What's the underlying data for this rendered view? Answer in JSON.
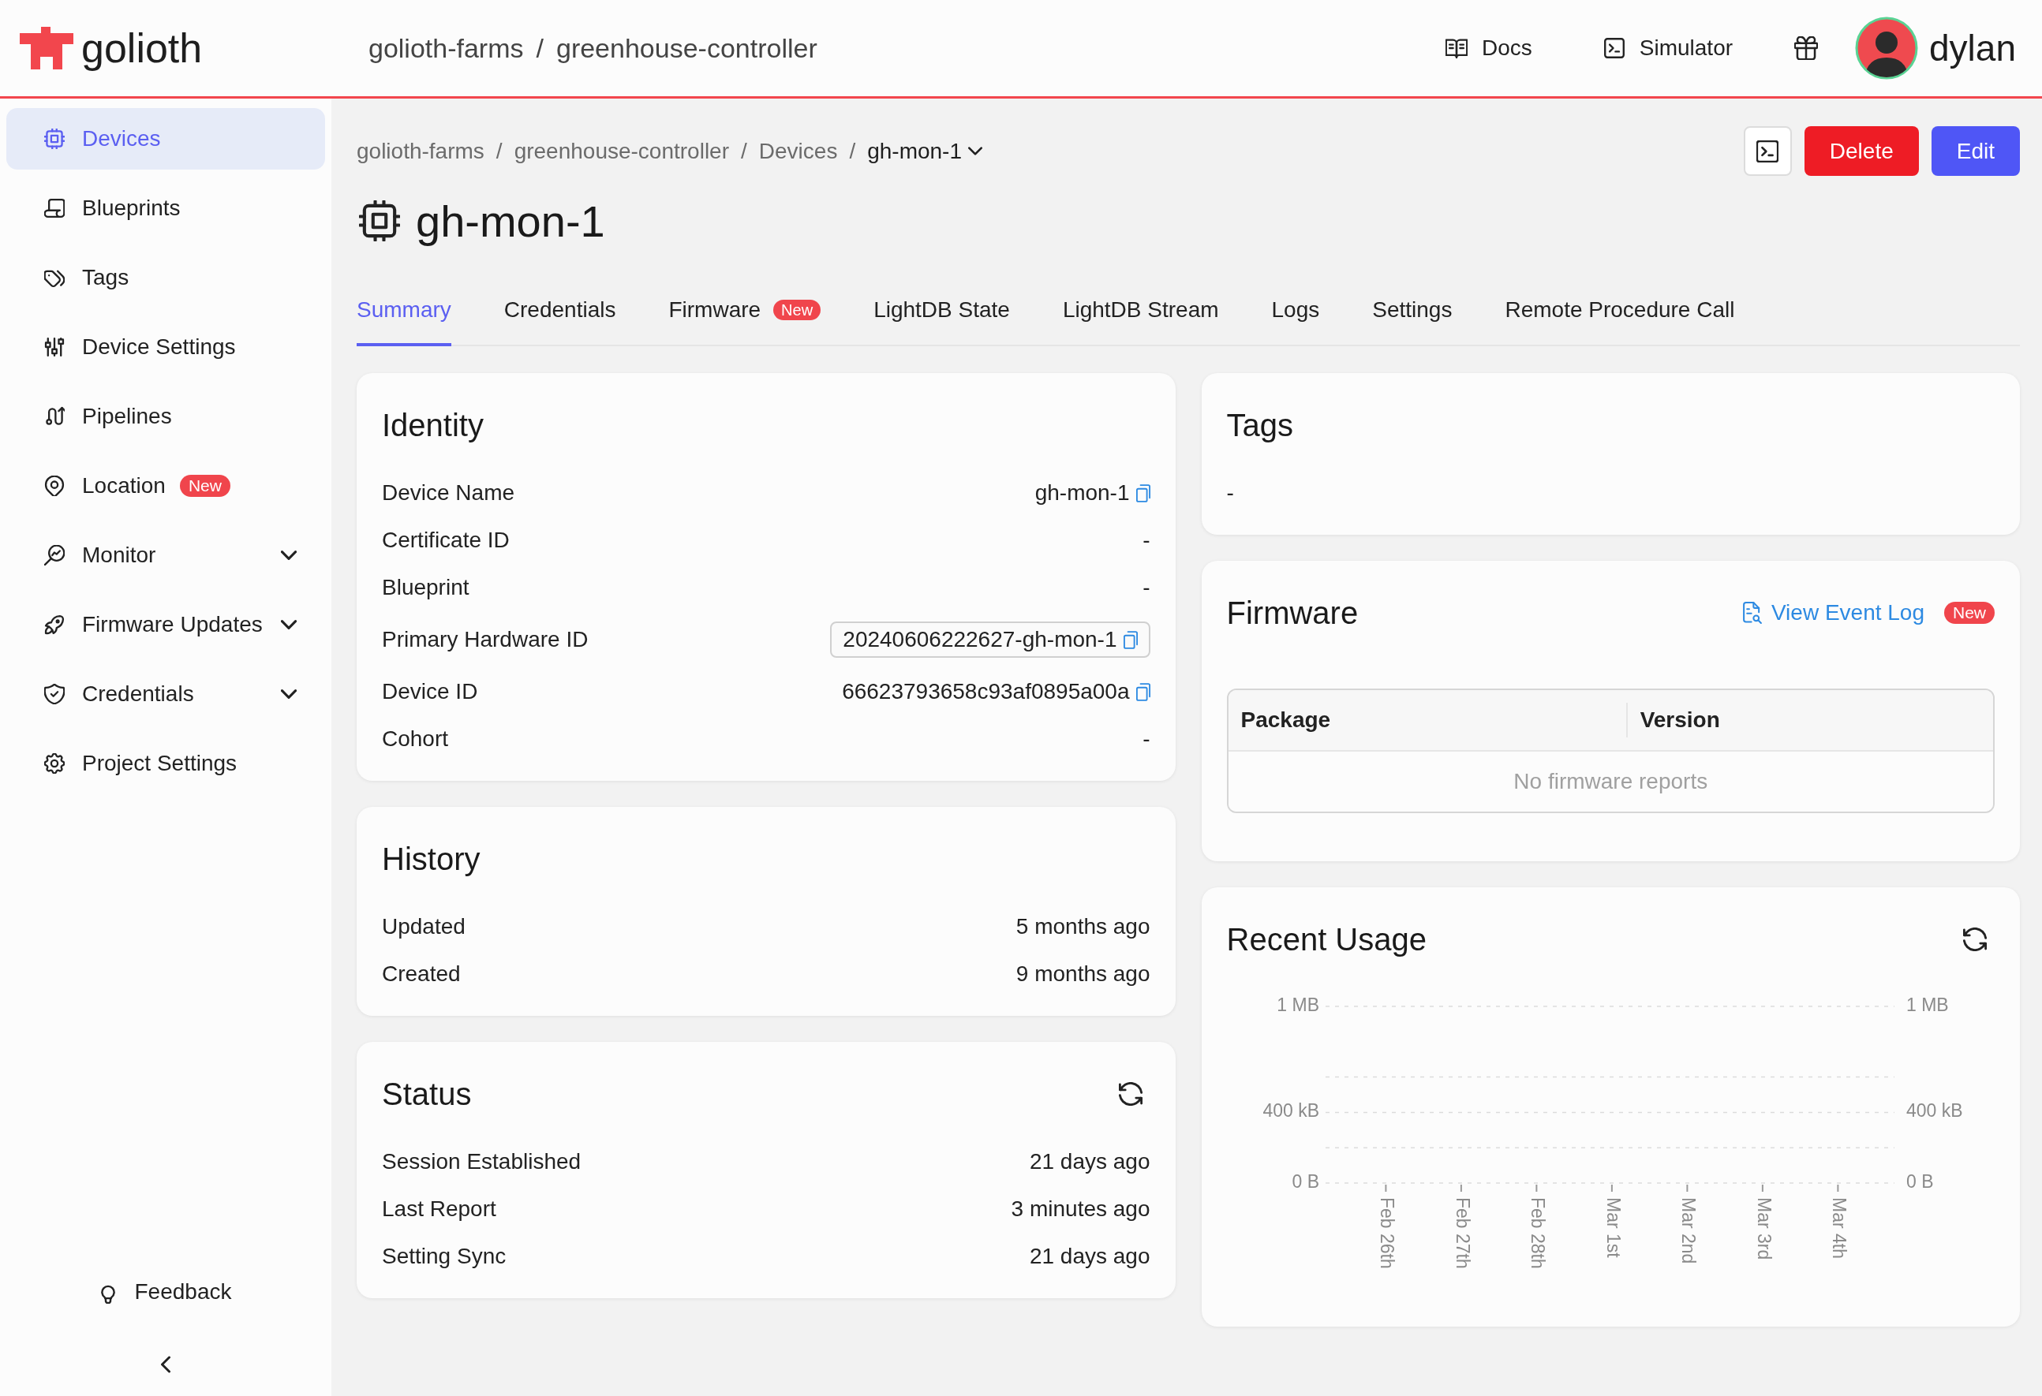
{
  "header": {
    "logo": "golioth",
    "breadcrumb": [
      {
        "kind": "link",
        "text": "golioth-farms"
      },
      {
        "kind": "separator",
        "text": "/"
      },
      {
        "kind": "link",
        "text": "greenhouse-controller"
      }
    ],
    "nav": [
      {
        "label": "Docs"
      },
      {
        "label": "Simulator"
      }
    ],
    "user": {
      "name": "dylan"
    }
  },
  "sidebar": {
    "items": [
      {
        "label": "Devices",
        "selected": true
      },
      {
        "label": "Blueprints",
        "selected": false
      },
      {
        "label": "Tags",
        "selected": false
      },
      {
        "label": "Device Settings",
        "selected": false
      },
      {
        "label": "Pipelines",
        "selected": false
      },
      {
        "label": "Location",
        "selected": false,
        "badge": "New"
      },
      {
        "label": "Monitor",
        "selected": false,
        "expanded": false
      },
      {
        "label": "Firmware Updates",
        "selected": false,
        "expanded": false
      },
      {
        "label": "Credentials",
        "selected": false,
        "expanded": false
      },
      {
        "label": "Project Settings",
        "selected": false
      }
    ],
    "feedback": "Feedback"
  },
  "breadcrumb": [
    {
      "kind": "link",
      "text": "golioth-farms"
    },
    {
      "kind": "separator",
      "text": "/"
    },
    {
      "kind": "link",
      "text": "greenhouse-controller"
    },
    {
      "kind": "separator",
      "text": "/"
    },
    {
      "kind": "link",
      "text": "Devices"
    },
    {
      "kind": "separator",
      "text": "/"
    },
    {
      "kind": "dropdown",
      "text": "gh-mon-1"
    }
  ],
  "actions": [
    {
      "kind": "icon"
    },
    {
      "kind": "danger",
      "label": "Delete"
    },
    {
      "kind": "primary",
      "label": "Edit"
    }
  ],
  "title": "gh-mon-1",
  "tabs": [
    {
      "label": "Summary",
      "selected": true
    },
    {
      "label": "Credentials",
      "selected": false
    },
    {
      "label": "Firmware",
      "selected": false,
      "badge": "New"
    },
    {
      "label": "LightDB State",
      "selected": false
    },
    {
      "label": "LightDB Stream",
      "selected": false
    },
    {
      "label": "Logs",
      "selected": false
    },
    {
      "label": "Settings",
      "selected": false
    },
    {
      "label": "Remote Procedure Call",
      "selected": false
    }
  ],
  "identity": {
    "title": "Identity",
    "rows": [
      {
        "kind": "copy",
        "label": "Device Name",
        "value": "gh-mon-1"
      },
      {
        "kind": "plain",
        "label": "Certificate ID",
        "value": "-"
      },
      {
        "kind": "plain",
        "label": "Blueprint",
        "value": "-"
      },
      {
        "kind": "boxed",
        "label": "Primary Hardware ID",
        "value": "20240606222627-gh-mon-1"
      },
      {
        "kind": "copy",
        "label": "Device ID",
        "value": "66623793658c93af0895a00a"
      },
      {
        "kind": "plain",
        "label": "Cohort",
        "value": "-"
      }
    ]
  },
  "history": {
    "title": "History",
    "rows": [
      {
        "label": "Updated",
        "value": "5 months ago"
      },
      {
        "label": "Created",
        "value": "9 months ago"
      }
    ]
  },
  "status": {
    "title": "Status",
    "rows": [
      {
        "label": "Session Established",
        "value": "21 days ago"
      },
      {
        "label": "Last Report",
        "value": "3 minutes ago"
      },
      {
        "label": "Setting Sync",
        "value": "21 days ago"
      }
    ]
  },
  "tags": {
    "title": "Tags",
    "value": "-"
  },
  "firmware": {
    "title": "Firmware",
    "link": "View Event Log",
    "badge": "New",
    "table": {
      "columns": [
        "Package",
        "Version"
      ],
      "empty": "No firmware reports"
    }
  },
  "recent_usage": {
    "title": "Recent Usage",
    "chart": {
      "y_labels": [
        "1 MB",
        "400 kB",
        "0 B"
      ],
      "y2_labels": [
        "1 MB",
        "400 kB",
        "0 B"
      ],
      "x_labels": [
        "Feb 26th",
        "Feb 27th",
        "Feb 28th",
        "Mar 1st",
        "Mar 2nd",
        "Mar 3rd",
        "Mar 4th"
      ]
    }
  }
}
